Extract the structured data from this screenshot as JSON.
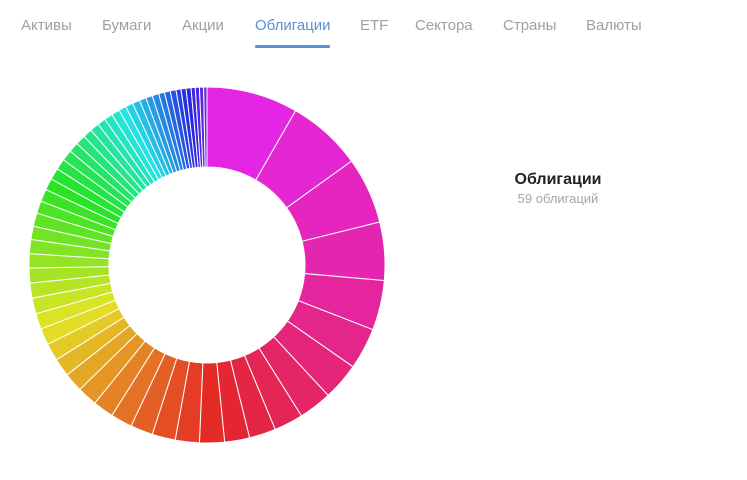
{
  "tabs": [
    {
      "label": "Активы",
      "active": false
    },
    {
      "label": "Бумаги",
      "active": false
    },
    {
      "label": "Акции",
      "active": false
    },
    {
      "label": "Облигации",
      "active": true
    },
    {
      "label": "ETF",
      "active": false
    },
    {
      "label": "Сектора",
      "active": false
    },
    {
      "label": "Страны",
      "active": false
    },
    {
      "label": "Валюты",
      "active": false
    }
  ],
  "tooltip": {
    "title": "Облигации",
    "subtitle": "59 облигаций"
  },
  "colors": {
    "active_tab": "#5b8fd6",
    "inactive_tab": "#9aa1a9"
  },
  "chart_data": {
    "type": "pie",
    "donut": true,
    "slice_count": 59,
    "values": [
      11,
      9,
      8,
      7,
      6,
      5,
      4.5,
      4,
      3.5,
      3.2,
      3,
      3,
      2.9,
      2.8,
      2.7,
      2.6,
      2.5,
      2.4,
      2.3,
      2.2,
      2.1,
      2.0,
      1.9,
      1.9,
      1.8,
      1.8,
      1.7,
      1.7,
      1.6,
      1.6,
      1.5,
      1.5,
      1.4,
      1.4,
      1.3,
      1.3,
      1.2,
      1.2,
      1.1,
      1.1,
      1.0,
      1.0,
      1.0,
      0.9,
      0.9,
      0.9,
      0.8,
      0.8,
      0.8,
      0.7,
      0.7,
      0.7,
      0.6,
      0.6,
      0.6,
      0.5,
      0.5,
      0.5,
      0.4
    ]
  }
}
